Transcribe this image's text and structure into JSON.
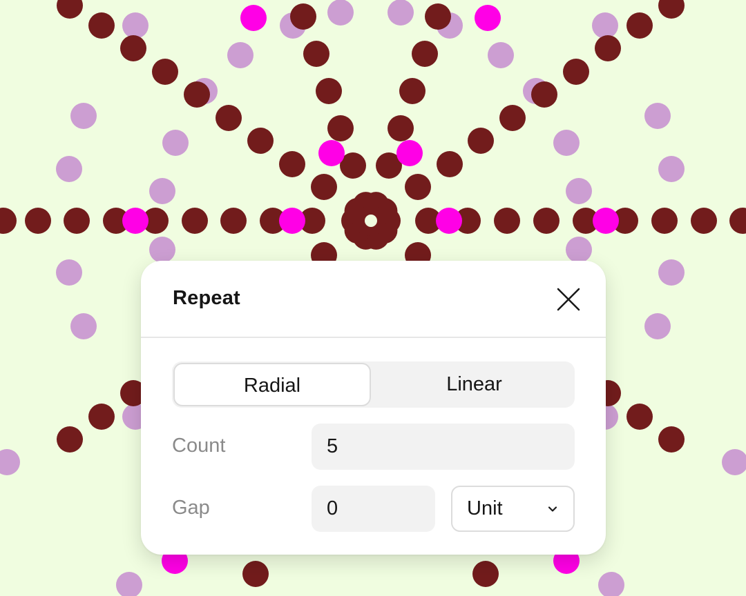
{
  "canvas": {
    "background_color": "#f0fde0",
    "dot_colors": {
      "dark": "#721c1c",
      "magenta": "#ff00e6",
      "lilac": "#cc9ed2"
    }
  },
  "dialog": {
    "title": "Repeat",
    "close_icon": "close-icon",
    "mode_tabs": [
      {
        "label": "Radial",
        "selected": true
      },
      {
        "label": "Linear",
        "selected": false
      }
    ],
    "count": {
      "label": "Count",
      "value": "5"
    },
    "gap": {
      "label": "Gap",
      "value": "0"
    },
    "unit_select": {
      "value": "Unit",
      "icon": "chevron-down-icon"
    }
  }
}
